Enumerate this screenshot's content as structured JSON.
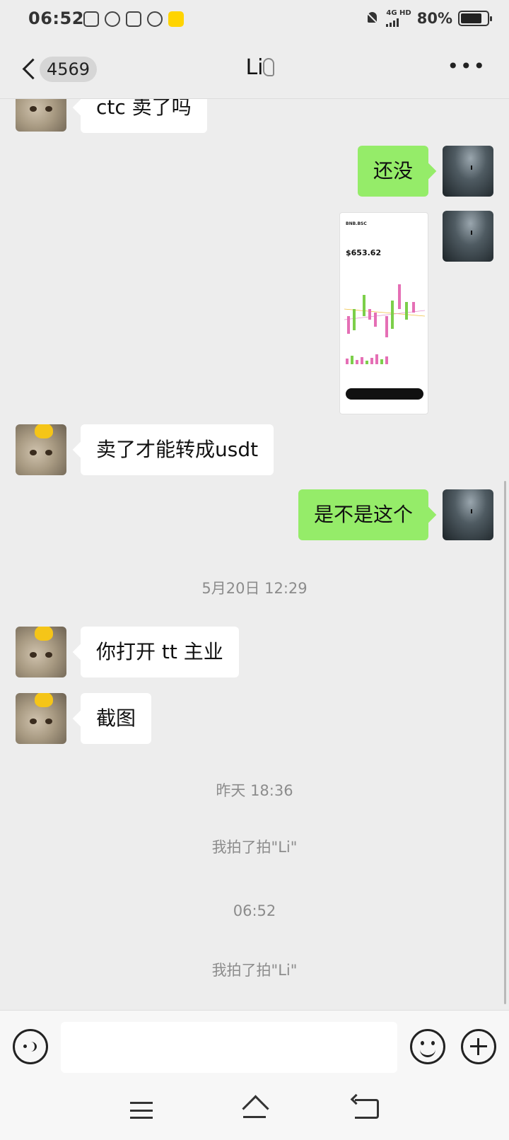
{
  "status_bar": {
    "time": "06:52",
    "network": "4G HD",
    "battery": "80%",
    "battery_level": 0.8
  },
  "header": {
    "unread_count": "4569",
    "title": "Li"
  },
  "messages": [
    {
      "side": "left",
      "type": "text",
      "text": "ctc 卖了吗"
    },
    {
      "side": "right",
      "type": "text",
      "text": "还没"
    },
    {
      "side": "right",
      "type": "image",
      "shot": {
        "header": "BNB.BSC",
        "price": "$653.62"
      }
    },
    {
      "side": "left",
      "type": "text",
      "text": "卖了才能转成usdt"
    },
    {
      "side": "right",
      "type": "text",
      "text": "是不是这个"
    },
    {
      "type": "time",
      "text": "5月20日 12:29"
    },
    {
      "side": "left",
      "type": "text",
      "text": "你打开 tt 主业"
    },
    {
      "side": "left",
      "type": "text",
      "text": "截图"
    },
    {
      "type": "time",
      "text": "昨天 18:36"
    },
    {
      "type": "system",
      "text": "我拍了拍\"Li\""
    },
    {
      "type": "time",
      "text": "06:52"
    },
    {
      "type": "system",
      "text": "我拍了拍\"Li\""
    }
  ],
  "input": {
    "value": ""
  },
  "colors": {
    "background": "#ededed",
    "bubble_self": "#95ec69",
    "bubble_other": "#ffffff"
  }
}
